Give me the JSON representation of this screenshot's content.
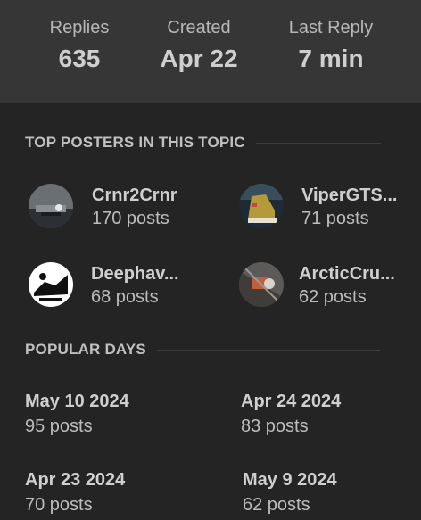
{
  "stats": [
    {
      "label": "Replies",
      "value": "635"
    },
    {
      "label": "Created",
      "value": "Apr 22"
    },
    {
      "label": "Last Reply",
      "value": "7 min"
    }
  ],
  "top_posters": {
    "title": "TOP POSTERS IN THIS TOPIC",
    "posters": [
      {
        "name": "Crnr2Crnr",
        "posts": "170 posts"
      },
      {
        "name": "ViperGTS...",
        "posts": "71 posts"
      },
      {
        "name": "Deephav...",
        "posts": "68 posts"
      },
      {
        "name": "ArcticCru...",
        "posts": "62 posts"
      }
    ]
  },
  "popular_days": {
    "title": "POPULAR DAYS",
    "days": [
      {
        "date": "May 10 2024",
        "posts": "95 posts"
      },
      {
        "date": "Apr 24 2024",
        "posts": "83 posts"
      },
      {
        "date": "Apr 23 2024",
        "posts": "70 posts"
      },
      {
        "date": "May 9 2024",
        "posts": "62 posts"
      }
    ]
  },
  "colors": {
    "background": "#242424",
    "stats_band": "#363636",
    "primary_text": "#cfcfcf",
    "muted_text": "#b7b7b7"
  }
}
